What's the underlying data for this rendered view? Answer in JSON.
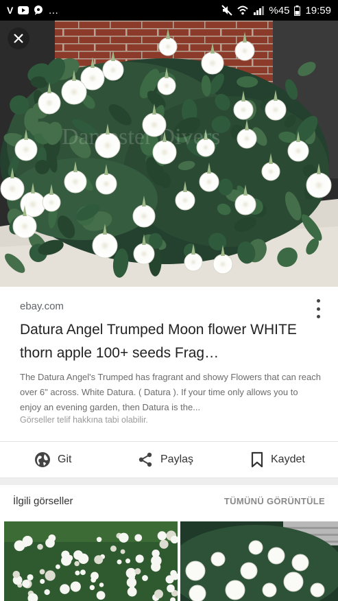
{
  "status_bar": {
    "left_text": "…",
    "battery_percent": "%45",
    "time": "19:59"
  },
  "result": {
    "source": "ebay.com",
    "title": "Datura Angel Trumped Moon flower WHITE thorn apple 100+ seeds Frag…",
    "description": "The Datura Angel's Trumped has fragrant and showy Flowers that can reach over 6\" across. White Datura. ( Datura ). If your time only allows you to enjoy an evening garden, then Datura is the...",
    "copyright": "Görseller telif hakkına tabi olabilir."
  },
  "actions": {
    "visit": "Git",
    "share": "Paylaş",
    "save": "Kaydet"
  },
  "related": {
    "title": "İlgili görseller",
    "view_all": "TÜMÜNÜ GÖRÜNTÜLE"
  },
  "colors": {
    "status_bar": "#000000",
    "text_primary": "#222222",
    "text_secondary": "#6b6b6b",
    "brick": "#8c3b2a",
    "foliage": "#2f4f3a",
    "flower": "#f4f4f0"
  },
  "icons": [
    "close-icon",
    "more-vert-icon",
    "globe-icon",
    "share-icon",
    "bookmark-icon",
    "wifi-icon",
    "signal-icon",
    "battery-icon",
    "mute-icon"
  ]
}
